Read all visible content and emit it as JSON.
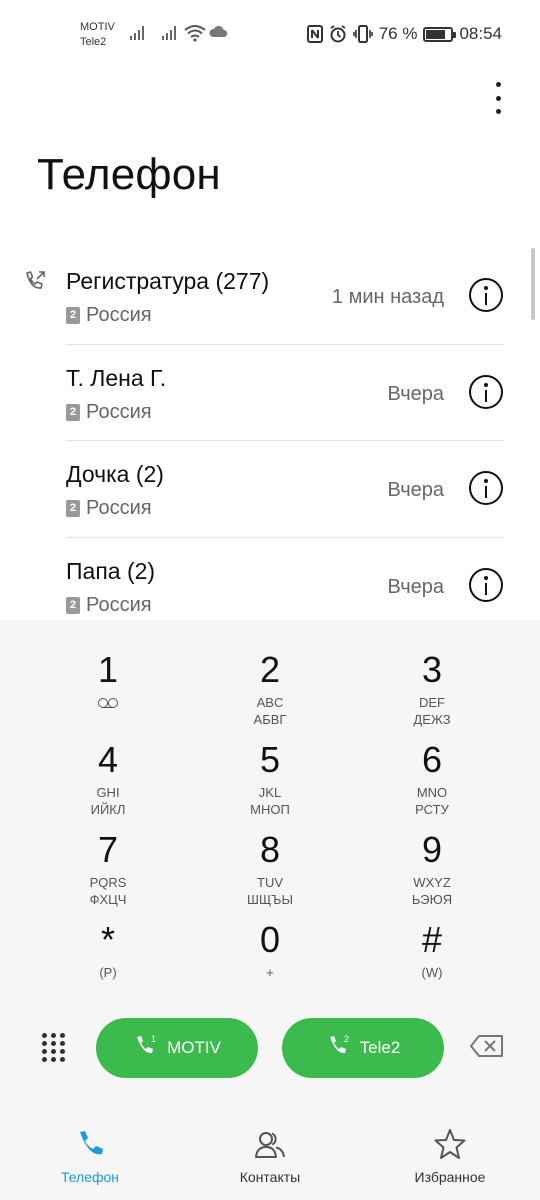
{
  "status_bar": {
    "carrier1": "MOTIV",
    "carrier2": "Tele2",
    "battery_percent": "76 %",
    "battery_level": 0.76,
    "time": "08:54"
  },
  "header": {
    "title": "Телефон"
  },
  "call_log": [
    {
      "name": "Регистратура (277)",
      "sim": "2",
      "location": "Россия",
      "time": "1 мин назад",
      "outgoing": true
    },
    {
      "name": "Т. Лена Г.",
      "sim": "2",
      "location": "Россия",
      "time": "Вчера",
      "outgoing": false
    },
    {
      "name": "Дочка (2)",
      "sim": "2",
      "location": "Россия",
      "time": "Вчера",
      "outgoing": false
    },
    {
      "name": "Папа (2)",
      "sim": "2",
      "location": "Россия",
      "time": "Вчера",
      "outgoing": false
    }
  ],
  "dialpad": {
    "keys": [
      {
        "digit": "1",
        "line1": "",
        "line2": "",
        "icon": "voicemail-icon"
      },
      {
        "digit": "2",
        "line1": "ABC",
        "line2": "АБВГ"
      },
      {
        "digit": "3",
        "line1": "DEF",
        "line2": "ДЕЖЗ"
      },
      {
        "digit": "4",
        "line1": "GHI",
        "line2": "ИЙКЛ"
      },
      {
        "digit": "5",
        "line1": "JKL",
        "line2": "МНОП"
      },
      {
        "digit": "6",
        "line1": "MNO",
        "line2": "РСТУ"
      },
      {
        "digit": "7",
        "line1": "PQRS",
        "line2": "ФХЦЧ"
      },
      {
        "digit": "8",
        "line1": "TUV",
        "line2": "ШЩЪЫ"
      },
      {
        "digit": "9",
        "line1": "WXYZ",
        "line2": "ЬЭЮЯ"
      },
      {
        "digit": "*",
        "line1": "(P)",
        "line2": ""
      },
      {
        "digit": "0",
        "line1": "+",
        "line2": ""
      },
      {
        "digit": "#",
        "line1": "(W)",
        "line2": ""
      }
    ],
    "call_buttons": [
      {
        "sim": "1",
        "label": "MOTIV"
      },
      {
        "sim": "2",
        "label": "Tele2"
      }
    ]
  },
  "bottom_nav": [
    {
      "label": "Телефон",
      "icon": "phone-icon",
      "active": true
    },
    {
      "label": "Контакты",
      "icon": "contacts-icon",
      "active": false
    },
    {
      "label": "Избранное",
      "icon": "star-icon",
      "active": false
    }
  ],
  "colors": {
    "accent": "#1a9be0",
    "call_green": "#3dba4e",
    "dialpad_bg": "#f6f6f6"
  }
}
